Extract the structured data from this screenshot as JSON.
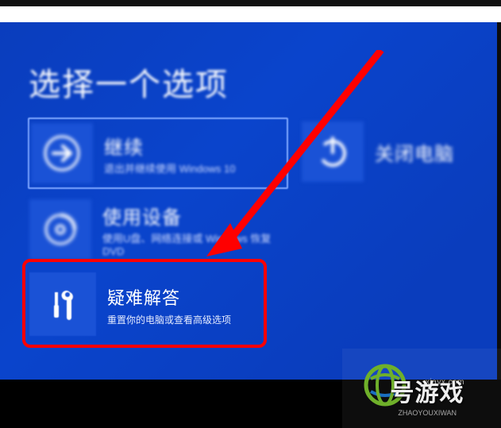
{
  "heading": "选择一个选项",
  "tiles": {
    "continue": {
      "title": "继续",
      "sub": "退出并继续使用 Windows 10",
      "icon": "arrow-right-icon"
    },
    "device": {
      "title": "使用设备",
      "sub": "使用U盘、网络连接或 Windows 恢复 DVD",
      "icon": "disc-icon"
    },
    "troubleshoot": {
      "title": "疑难解答",
      "sub": "重置你的电脑或查看高级选项",
      "icon": "tools-icon"
    },
    "power": {
      "title": "关闭电脑",
      "icon": "power-icon"
    }
  },
  "watermark": {
    "site": "号游戏",
    "domain": "xiayx.com",
    "sub": "ZHAOYOUXIWAN"
  }
}
